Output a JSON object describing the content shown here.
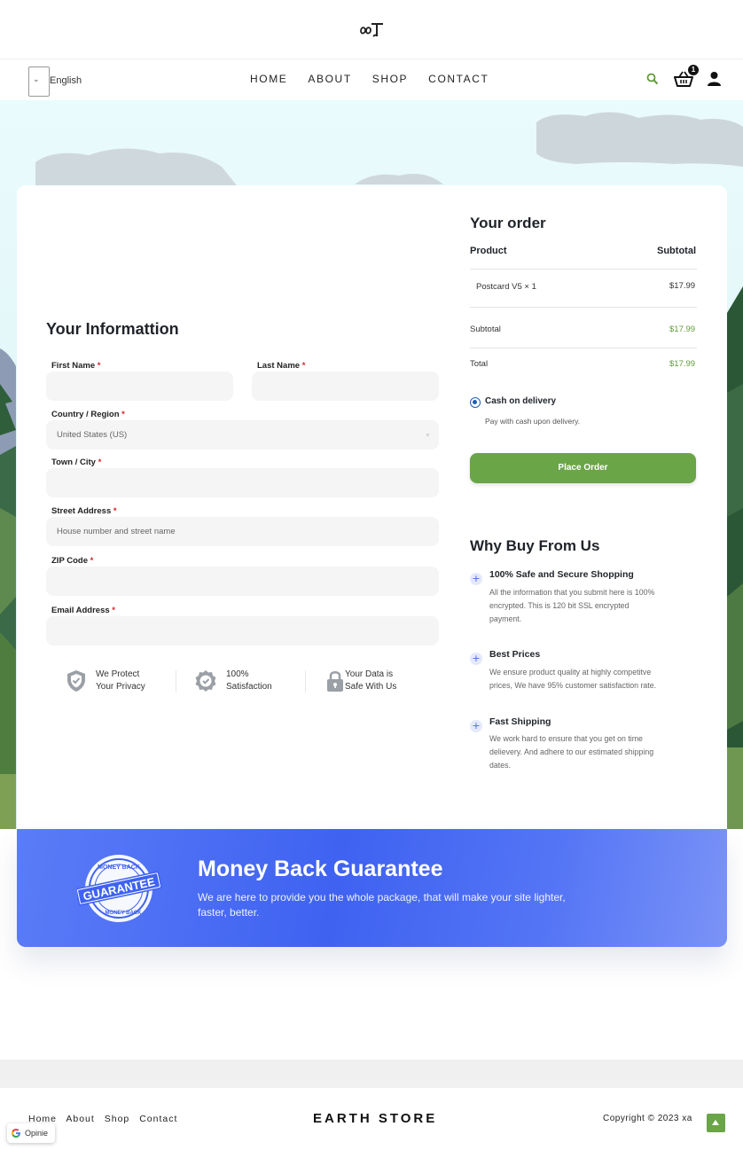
{
  "header": {
    "language": "English",
    "nav": [
      "HOME",
      "ABOUT",
      "SHOP",
      "CONTACT"
    ],
    "cart_count": "1"
  },
  "form": {
    "title": "Your Informattion",
    "fields": {
      "first_name": "First Name",
      "last_name": "Last Name",
      "country": "Country / Region",
      "country_value": "United States (US)",
      "city": "Town / City",
      "street": "Street Address",
      "street_placeholder": "House number and street name",
      "zip": "ZIP Code",
      "email": "Email Address",
      "required_mark": "*"
    },
    "trust": [
      {
        "line1": "We Protect",
        "line2": "Your Privacy"
      },
      {
        "line1": "100%",
        "line2": "Satisfaction"
      },
      {
        "line1": "Your Data is",
        "line2": "Safe With Us"
      }
    ]
  },
  "order": {
    "title": "Your order",
    "col_product": "Product",
    "col_subtotal": "Subtotal",
    "item_name": "Postcard V5 × 1",
    "item_price": "$17.99",
    "subtotal_label": "Subtotal",
    "subtotal_value": "$17.99",
    "total_label": "Total",
    "total_value": "$17.99",
    "payment_label": "Cash on delivery",
    "payment_desc": "Pay with cash upon delivery.",
    "place_order": "Place Order"
  },
  "why": {
    "title": "Why Buy From Us",
    "items": [
      {
        "title": "100% Safe and Secure Shopping",
        "lines": [
          "All the information that you submit here is 100%",
          "encrypted. This is 120 bit SSL encrypted",
          "payment."
        ]
      },
      {
        "title": "Best Prices",
        "lines": [
          "We ensure product quality at highly competitve",
          "prices, We have 95% customer satisfaction rate."
        ]
      },
      {
        "title": "Fast Shipping",
        "lines": [
          "We work hard to ensure that you get on time",
          "delievery. And adhere to our estimated shipping",
          "dates."
        ]
      }
    ]
  },
  "guarantee": {
    "title": "Money Back Guarantee",
    "text": "We are here to provide you the whole package, that will make your site lighter, faster, better.",
    "seal_top": "MONEY BACK",
    "seal_main": "GUARANTEE",
    "seal_bottom": "MONEY BACK"
  },
  "footer": {
    "links": [
      "Home",
      "About",
      "Shop",
      "Contact"
    ],
    "brand": "EARTH STORE",
    "copyright": "Copyright © 2023 xa",
    "reviews": "Opinie"
  },
  "colors": {
    "accent_green": "#6aa547",
    "banner_blue": "#3f62f1",
    "radio_blue": "#1e5fb3"
  }
}
